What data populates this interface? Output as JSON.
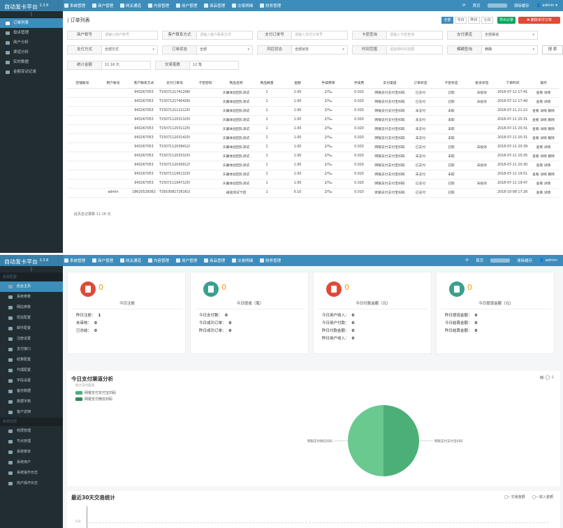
{
  "brand": {
    "name1": "自动发卡平台",
    "ver1": "2.3.8",
    "name2": "自动发卡平台",
    "ver2": "2.3.8"
  },
  "nav": [
    "系统管理",
    "商户管理",
    "网关通道",
    "内容管理",
    "用户管理",
    "商品管理",
    "交易明细",
    "财务管理"
  ],
  "top_right": {
    "refresh": "⟳",
    "home": "首页",
    "clear": "清除缓存",
    "user": "admin"
  },
  "sidebar1": [
    {
      "label": "订单列表",
      "active": true
    },
    {
      "label": "投诉管理",
      "active": false
    },
    {
      "label": "商户分析",
      "active": false
    },
    {
      "label": "渠道分析",
      "active": false
    },
    {
      "label": "实时数据",
      "active": false
    },
    {
      "label": "金额变动记录",
      "active": false
    }
  ],
  "sidebar2_head1": "系统配置",
  "sidebar2a": [
    {
      "label": "后台主页",
      "active": true
    },
    {
      "label": "系统参数",
      "active": false
    },
    {
      "label": "网站参数",
      "active": false
    },
    {
      "label": "短信配置",
      "active": false
    },
    {
      "label": "邮件配置",
      "active": false
    },
    {
      "label": "注册设置",
      "active": false
    },
    {
      "label": "支付接口",
      "active": false
    },
    {
      "label": "结算配置",
      "active": false
    },
    {
      "label": "代理配置",
      "active": false
    },
    {
      "label": "字段设置",
      "active": false
    },
    {
      "label": "备份数据",
      "active": false
    },
    {
      "label": "数据字典",
      "active": false
    },
    {
      "label": "客户返佣",
      "active": false
    }
  ],
  "sidebar2_head2": "系统权限",
  "sidebar2b": [
    {
      "label": "权限管理",
      "active": false
    },
    {
      "label": "节点管理",
      "active": false
    },
    {
      "label": "系统菜单",
      "active": false
    },
    {
      "label": "系统用户",
      "active": false
    },
    {
      "label": "系统操作日志",
      "active": false
    },
    {
      "label": "商户操作日志",
      "active": false
    }
  ],
  "orders": {
    "title": "订单列表",
    "tabs": [
      "全部",
      "今日",
      "昨日",
      "七日"
    ],
    "export_btn": "导出记录",
    "delete_btn": "删除未付订单",
    "filters": [
      [
        {
          "label": "商户账号",
          "placeholder": "请输入商户账号"
        },
        {
          "label": "客户联系方式",
          "placeholder": "请输入客户联系方式"
        },
        {
          "label": "支付订单号",
          "placeholder": "请输入支付订单号"
        },
        {
          "label": "卡密查询",
          "placeholder": "请输入卡密查询"
        },
        {
          "label": "支付渠道",
          "placeholder": "全部渠道",
          "select": true
        }
      ],
      [
        {
          "label": "支付方式",
          "placeholder": "全部方式",
          "select": true
        },
        {
          "label": "订单状态",
          "placeholder": "全部",
          "select": true
        },
        {
          "label": "风控状态",
          "placeholder": "全部状态",
          "select": true
        },
        {
          "label": "时间范围",
          "placeholder": "请选择时间范围"
        },
        {
          "label": "模糊查询",
          "placeholder": "精确",
          "select": true
        }
      ]
    ],
    "search_btn": "搜 索",
    "stats": [
      {
        "label": "统计金额",
        "value": "11.16 元"
      },
      {
        "label": "交易笔数",
        "value": "12 笔"
      }
    ],
    "columns": [
      "店铺账号",
      "用户账号",
      "客户联系方式",
      "支付订单号",
      "卡密密码",
      "商品名称",
      "商品数量",
      "金额",
      "手续费率",
      "手续费",
      "支付渠道",
      "订单状态",
      "卡密状态",
      "投诉状态",
      "下单时间",
      "操作"
    ],
    "rows": [
      [
        "",
        "",
        "943267053",
        "T15071217412060002",
        "",
        "天翼体验团队测试",
        "1",
        "1.00",
        "2/‰",
        "0.020",
        "网银支付支付宝扫码",
        "已支付",
        "已取",
        "未投诉",
        "2018-07-12 17:41:58",
        "查看 详情"
      ],
      [
        "",
        "",
        "943267053",
        "T15071217404260053",
        "",
        "天翼体验团队测试",
        "1",
        "1.00",
        "2/‰",
        "0.020",
        "网银支付支付宝扫码",
        "已支付",
        "已取",
        "未投诉",
        "2018-07-12 17:40:44",
        "查看 详情"
      ],
      [
        "",
        "",
        "943267053",
        "T15071211221250040",
        "",
        "天翼体验团队测试",
        "1",
        "1.00",
        "2/‰",
        "0.020",
        "网银支付支付宝扫码",
        "未支付",
        "未取",
        "",
        "2018-07-11 21:22:16",
        "查看 详情 删除"
      ],
      [
        "",
        "",
        "943267053",
        "T15071120313250097",
        "",
        "天翼体验团队测试",
        "1",
        "1.00",
        "2/‰",
        "0.020",
        "网银支付支付宝扫码",
        "未支付",
        "未取",
        "",
        "2018-07-11 20:31:34",
        "查看 详情 删除"
      ],
      [
        "",
        "",
        "943267053",
        "T15071120311250075",
        "",
        "天翼体验团队测试",
        "1",
        "1.00",
        "2/‰",
        "0.020",
        "网银支付支付宝扫码",
        "未支付",
        "未取",
        "",
        "2018-07-11 20:31:20",
        "查看 详情 删除"
      ],
      [
        "",
        "",
        "943267053",
        "T15071120314250022",
        "",
        "天翼体验团队测试",
        "1",
        "1.00",
        "2/‰",
        "0.020",
        "网银支付支付宝扫码",
        "未支付",
        "未取",
        "",
        "2018-07-11 20:31:44",
        "查看 详情 删除"
      ],
      [
        "",
        "",
        "943267053",
        "T15071120394120065",
        "",
        "天翼体验团队测试",
        "1",
        "1.00",
        "2/‰",
        "0.020",
        "网银支付支付宝扫码",
        "已支付",
        "已取",
        "未投诉",
        "2018-07-11 20:39:59",
        "查看 详情"
      ],
      [
        "",
        "",
        "943267053",
        "T15071120353250018",
        "",
        "天翼体验团队测试",
        "1",
        "1.00",
        "2/‰",
        "0.020",
        "网银支付支付宝扫码",
        "未支付",
        "未取",
        "",
        "2018-07-11 20:35:32",
        "查看 详情 删除"
      ],
      [
        "",
        "",
        "943267053",
        "T15071120300125076",
        "",
        "天翼体验团队测试",
        "1",
        "1.00",
        "2/‰",
        "0.020",
        "网银支付支付宝扫码",
        "已支付",
        "已取",
        "未投诉",
        "2018-07-11 20:30:09",
        "查看 详情"
      ],
      [
        "",
        "",
        "943267053",
        "T15071119513250053",
        "",
        "天翼体验团队测试",
        "1",
        "1.00",
        "2/‰",
        "0.020",
        "网银支付支付宝扫码",
        "未支付",
        "未取",
        "",
        "2018-07-11 19:51:28",
        "查看 详情 删除"
      ],
      [
        "",
        "",
        "943267053",
        "T15071119471250079",
        "",
        "天翼体验团队测试",
        "1",
        "1.00",
        "2/‰",
        "0.020",
        "网银支付支付宝扫码",
        "已支付",
        "已取",
        "未投诉",
        "2018-07-11 19:47:03",
        "查看 详情"
      ],
      [
        "",
        "admin",
        "18620528362",
        "T181008172616105",
        "",
        "通道测试卡密",
        "1",
        "0.10",
        "2/‰",
        "0.010",
        "余额支付支付宝扫码",
        "已支付",
        "已取",
        "",
        "2018-10-08 17:26:16",
        "查看 详情"
      ]
    ],
    "total": "此页总记录数 11.16 元"
  },
  "dashboard": {
    "cards": [
      {
        "value": "0",
        "title": "今日注册",
        "color": "#dd4b39",
        "lines": [
          {
            "label": "昨日注册：",
            "value": "1"
          },
          {
            "label": "未审核：",
            "value": "0"
          },
          {
            "label": "已冻结：",
            "value": "0"
          }
        ]
      },
      {
        "value": "0",
        "title": "今日提成（笔）",
        "color": "#39a08e",
        "lines": [
          {
            "label": "今日支付数：",
            "value": "0"
          },
          {
            "label": "今日成功订单：",
            "value": "0"
          },
          {
            "label": "昨日成功订单：",
            "value": "0"
          }
        ]
      },
      {
        "value": "0",
        "title": "今日付款金额（元）",
        "color": "#dd4b39",
        "lines": [
          {
            "label": "今日用户收入：",
            "value": "0"
          },
          {
            "label": "今日用户付款：",
            "value": "0"
          },
          {
            "label": "昨日付款金额：",
            "value": "0"
          },
          {
            "label": "昨日用户收入：",
            "value": "0"
          }
        ]
      },
      {
        "value": "0",
        "title": "今日提现金额（元）",
        "color": "#39a08e",
        "lines": [
          {
            "label": "昨日提现金额：",
            "value": "0"
          },
          {
            "label": "今日结算金额：",
            "value": "0"
          },
          {
            "label": "昨日结算金额：",
            "value": "0"
          }
        ]
      }
    ],
    "pay_title": "今日支付渠道分析",
    "pay_sub": "统计支付渠道",
    "legend": [
      {
        "name": "网银支付支付宝扫码",
        "color": "#4caf78"
      },
      {
        "name": "网银支付微信扫码",
        "color": "#2e8b57"
      }
    ],
    "tools": "▤ ◯ ⇩",
    "chart_data": {
      "type": "pie",
      "title": "今日支付渠道分析",
      "labels": [
        "网银支付支付宝扫码",
        "网银支付微信扫码"
      ],
      "values": [
        50,
        50
      ],
      "colors": [
        "#4caf78",
        "#69c98f"
      ]
    },
    "trade_title": "最近30天交易统计",
    "trade_legend": [
      {
        "name": "交易金额"
      },
      {
        "name": "收入金额"
      }
    ],
    "trade_tick": "5.0"
  }
}
